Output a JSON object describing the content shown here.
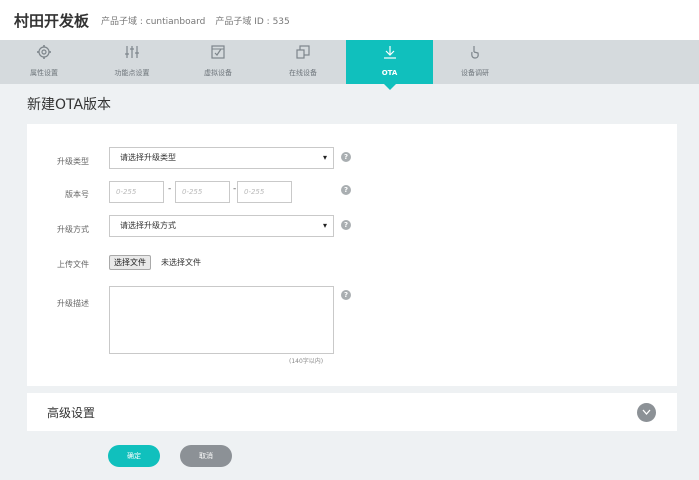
{
  "header": {
    "title": "村田开发板",
    "domain_text": "产品子域 : cuntianboard",
    "id_text": "产品子域 ID : 535"
  },
  "tabs": [
    {
      "label": "属性设置",
      "icon": "gear-icon"
    },
    {
      "label": "功能点设置",
      "icon": "sliders-icon"
    },
    {
      "label": "虚拟设备",
      "icon": "virtual-device-icon"
    },
    {
      "label": "在线设备",
      "icon": "online-device-icon"
    },
    {
      "label": "OTA",
      "icon": "download-icon",
      "active": true
    },
    {
      "label": "设备调研",
      "icon": "hand-icon"
    }
  ],
  "page": {
    "title": "新建OTA版本"
  },
  "form": {
    "upgrade_type": {
      "label": "升级类型",
      "value": "请选择升级类型"
    },
    "version": {
      "label": "版本号",
      "placeholders": [
        "0-255",
        "0-255",
        "0-255"
      ],
      "separator": "-"
    },
    "upgrade_method": {
      "label": "升级方式",
      "value": "请选择升级方式"
    },
    "upload": {
      "label": "上传文件",
      "button": "选择文件",
      "status": "未选择文件"
    },
    "description": {
      "label": "升级描述",
      "limit": "(140字以内)"
    },
    "help_glyph": "?",
    "caret": "▾"
  },
  "advanced": {
    "label": "高级设置"
  },
  "actions": {
    "ok": "确定",
    "cancel": "取消"
  },
  "colors": {
    "accent": "#10c0bd",
    "secondary": "#8c9196",
    "tabs_bg": "#d5dadd"
  }
}
